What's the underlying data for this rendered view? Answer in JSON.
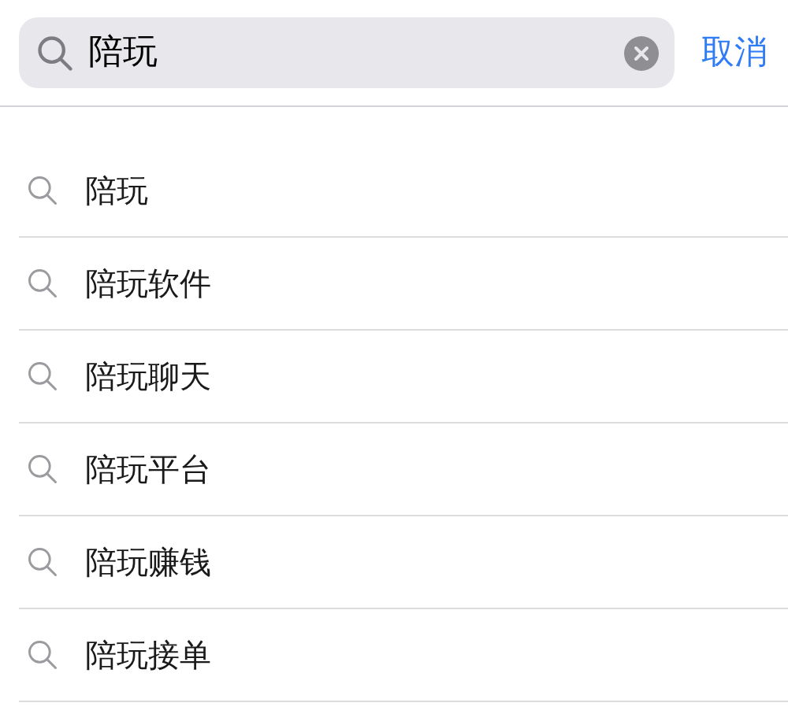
{
  "search": {
    "value": "陪玩",
    "cancel": "取消"
  },
  "suggestions": [
    {
      "text": "陪玩"
    },
    {
      "text": "陪玩软件"
    },
    {
      "text": "陪玩聊天"
    },
    {
      "text": "陪玩平台"
    },
    {
      "text": "陪玩赚钱"
    },
    {
      "text": "陪玩接单"
    }
  ]
}
